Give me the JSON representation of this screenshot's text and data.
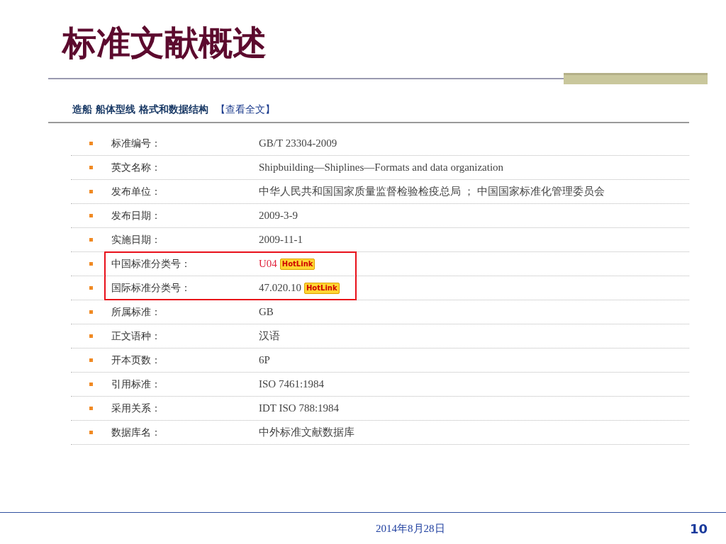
{
  "slide_title": "标准文献概述",
  "page": {
    "heading": "造船 船体型线 格式和数据结构",
    "heading_link": "【查看全文】",
    "rows": [
      {
        "label": "标准编号：",
        "value": "GB/T 23304-2009",
        "highlighted": false,
        "link": false
      },
      {
        "label": "英文名称：",
        "value": "Shipbuilding—Shiplines—Formats and data organization",
        "highlighted": false,
        "link": false
      },
      {
        "label": "发布单位：",
        "value": "中华人民共和国国家质量监督检验检疫总局 ； 中国国家标准化管理委员会",
        "highlighted": false,
        "link": false
      },
      {
        "label": "发布日期：",
        "value": "2009-3-9",
        "highlighted": false,
        "link": false
      },
      {
        "label": "实施日期：",
        "value": "2009-11-1",
        "highlighted": false,
        "link": false
      },
      {
        "label": "中国标准分类号：",
        "value": "U04",
        "badge": "HotLink",
        "highlighted": true,
        "link": true
      },
      {
        "label": "国际标准分类号：",
        "value": "47.020.10",
        "badge": "HotLink",
        "highlighted": true,
        "link": false
      },
      {
        "label": "所属标准：",
        "value": "GB",
        "highlighted": false,
        "link": false
      },
      {
        "label": "正文语种：",
        "value": "汉语",
        "highlighted": false,
        "link": false
      },
      {
        "label": "开本页数：",
        "value": "6P",
        "highlighted": false,
        "link": false
      },
      {
        "label": "引用标准：",
        "value": "ISO 7461:1984",
        "highlighted": false,
        "link": false
      },
      {
        "label": "采用关系：",
        "value": "IDT ISO 788:1984",
        "highlighted": false,
        "link": false
      },
      {
        "label": "数据库名：",
        "value": "中外标准文献数据库",
        "highlighted": false,
        "link": false
      }
    ]
  },
  "footer": {
    "date": "2014年8月28日",
    "page_number": "10"
  }
}
